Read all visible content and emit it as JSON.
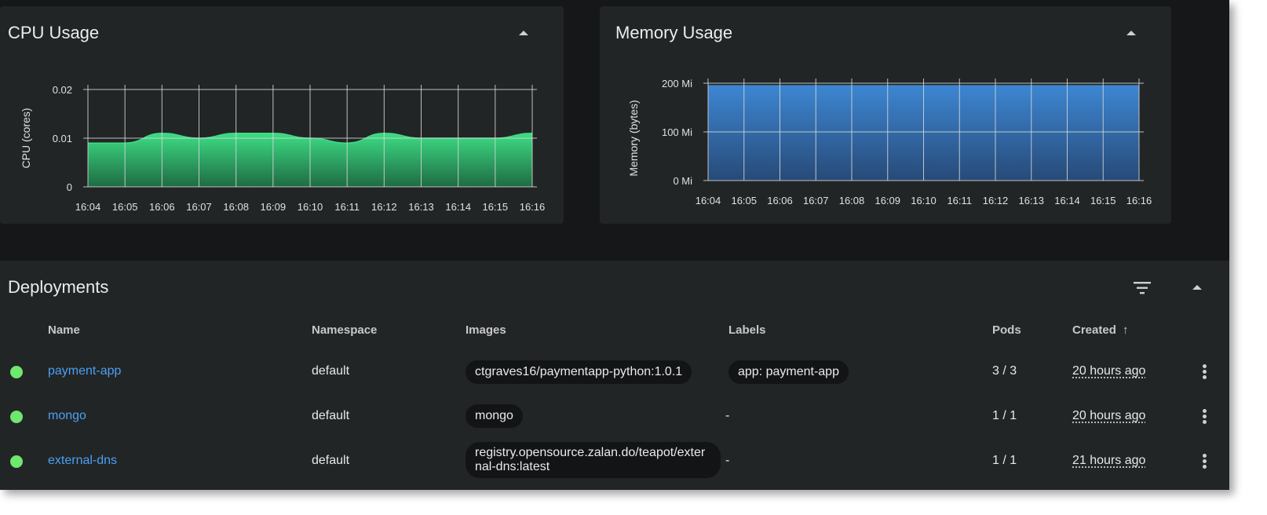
{
  "cpu": {
    "title": "CPU Usage",
    "chart_data": {
      "type": "area",
      "title": "CPU Usage",
      "ylabel": "CPU (cores)",
      "xlabel": "",
      "x": [
        "16:04",
        "16:05",
        "16:06",
        "16:07",
        "16:08",
        "16:09",
        "16:10",
        "16:11",
        "16:12",
        "16:13",
        "16:14",
        "16:15",
        "16:16"
      ],
      "values": [
        0.009,
        0.009,
        0.011,
        0.01,
        0.011,
        0.011,
        0.01,
        0.009,
        0.011,
        0.01,
        0.01,
        0.01,
        0.011
      ],
      "yticks": [
        "0",
        "0.01",
        "0.02"
      ],
      "ylim": [
        0,
        0.02
      ],
      "grid": true,
      "color": "#2ecc71"
    }
  },
  "memory": {
    "title": "Memory Usage",
    "chart_data": {
      "type": "area",
      "title": "Memory Usage",
      "ylabel": "Memory (bytes)",
      "xlabel": "",
      "x": [
        "16:04",
        "16:05",
        "16:06",
        "16:07",
        "16:08",
        "16:09",
        "16:10",
        "16:11",
        "16:12",
        "16:13",
        "16:14",
        "16:15",
        "16:16"
      ],
      "values": [
        195,
        195,
        195,
        195,
        195,
        195,
        195,
        195,
        195,
        195,
        195,
        195,
        195
      ],
      "yticks": [
        "0 Mi",
        "100 Mi",
        "200 Mi"
      ],
      "ylim": [
        0,
        200
      ],
      "grid": true,
      "color": "#3a7fc8"
    }
  },
  "deployments": {
    "title": "Deployments",
    "columns": {
      "name": "Name",
      "namespace": "Namespace",
      "images": "Images",
      "labels": "Labels",
      "pods": "Pods",
      "created": "Created",
      "sort_icon": "↑"
    },
    "rows": [
      {
        "status": "running",
        "name": "payment-app",
        "namespace": "default",
        "image": "ctgraves16/paymentapp-python:1.0.1",
        "label": "app: payment-app",
        "pods": "3 / 3",
        "created": "20 hours ago"
      },
      {
        "status": "running",
        "name": "mongo",
        "namespace": "default",
        "image": "mongo",
        "label": "-",
        "pods": "1 / 1",
        "created": "20 hours ago"
      },
      {
        "status": "running",
        "name": "external-dns",
        "namespace": "default",
        "image": "registry.opensource.zalan.do/teapot/external-dns:latest",
        "label": "-",
        "pods": "1 / 1",
        "created": "21 hours ago"
      }
    ]
  },
  "colors": {
    "status_ok": "#6ee86e",
    "link": "#4aa0f2",
    "card": "#222526",
    "background": "#161718"
  }
}
